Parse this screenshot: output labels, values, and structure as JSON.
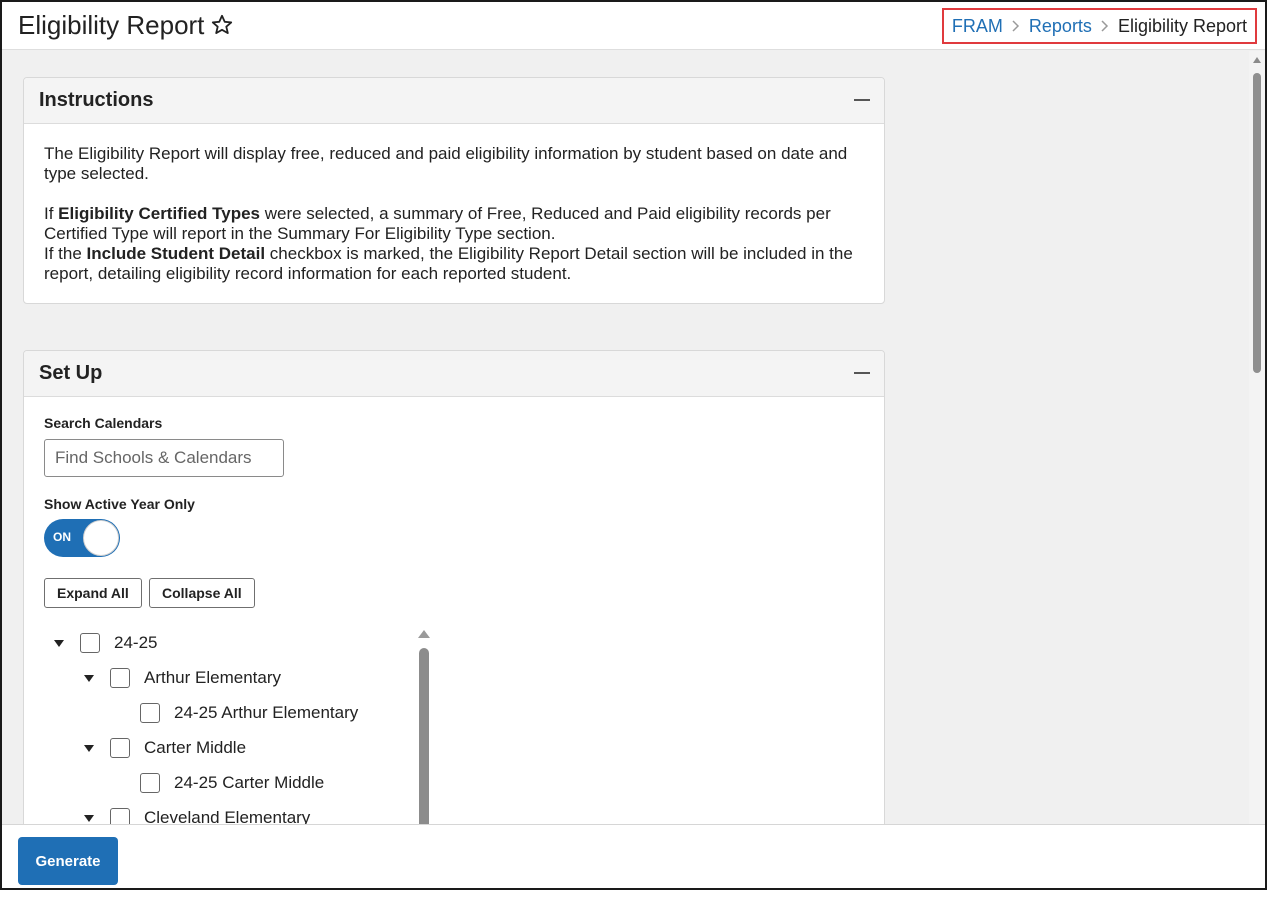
{
  "header": {
    "title": "Eligibility Report",
    "breadcrumb": [
      {
        "label": "FRAM"
      },
      {
        "label": "Reports"
      },
      {
        "label": "Eligibility Report"
      }
    ]
  },
  "instructions": {
    "title": "Instructions",
    "p1": "The Eligibility Report will display free, reduced and paid eligibility information by student based on date and type selected.",
    "p2_pre": "If ",
    "p2_bold": "Eligibility Certified Types",
    "p2_post": " were selected, a summary of Free, Reduced and Paid eligibility records per Certified Type will report in the Summary For Eligibility Type section.",
    "p3_pre": "If the ",
    "p3_bold": "Include Student Detail",
    "p3_post": " checkbox is marked, the Eligibility Report Detail section will be included in the report, detailing eligibility record information for each reported student."
  },
  "setup": {
    "title": "Set Up",
    "search_label": "Search Calendars",
    "search_placeholder": "Find Schools & Calendars",
    "active_year_label": "Show Active Year Only",
    "toggle_text": "ON",
    "expand_all": "Expand All",
    "collapse_all": "Collapse All",
    "tree": [
      {
        "label": "24-25",
        "level": 0,
        "expandable": true
      },
      {
        "label": "Arthur Elementary",
        "level": 1,
        "expandable": true
      },
      {
        "label": "24-25 Arthur Elementary",
        "level": 2,
        "expandable": false
      },
      {
        "label": "Carter Middle",
        "level": 1,
        "expandable": true
      },
      {
        "label": "24-25 Carter Middle",
        "level": 2,
        "expandable": false
      },
      {
        "label": "Cleveland Elementary",
        "level": 1,
        "expandable": true
      }
    ]
  },
  "footer": {
    "generate": "Generate"
  },
  "colors": {
    "accent": "#1f6fb5",
    "highlight_border": "#e03a3e"
  }
}
